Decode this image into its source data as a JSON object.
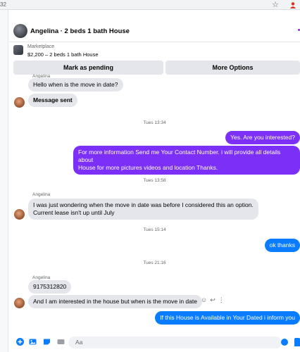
{
  "browser": {
    "tab_fragment": "32"
  },
  "header": {
    "title": "Angelina · 2 beds 1 bath House"
  },
  "listing": {
    "source": "Marketplace",
    "description": "$2,200 – 2 beds 1 bath House"
  },
  "actions": {
    "pending_label": "Mark as pending",
    "more_label": "More Options"
  },
  "messages": {
    "m1_sender": "Angelina",
    "m1": "Hello when is the move in date?",
    "m2": "Message sent",
    "ts1": "Tues 13:34",
    "m3": "Yes. Are you interested?",
    "m4_line1": "For more information  Send me Your Contact Number.  i will provide all details about",
    "m4_line2": "House for more pictures videos and  location Thanks.",
    "ts2": "Tues 13:58",
    "m5_sender": "Angelina",
    "m5_line1": "I was just wondering when the move in date was before I considered this an option.",
    "m5_line2": "Current lease isn't up until July",
    "ts3": "Tues 15:14",
    "m6": "ok thanks",
    "ts4": "Tues 21:16",
    "m7_sender": "Angelina",
    "m7": "9175312820",
    "m8": "And I am interested in the house but when is the move in date",
    "m9": "If this House is Available in Your Dated i inform you"
  },
  "composer": {
    "placeholder": "Aa"
  },
  "colors": {
    "outgoing_purple": "#7b2ff7",
    "outgoing_blue": "#0a7cff",
    "incoming_grey": "#e4e6eb"
  }
}
